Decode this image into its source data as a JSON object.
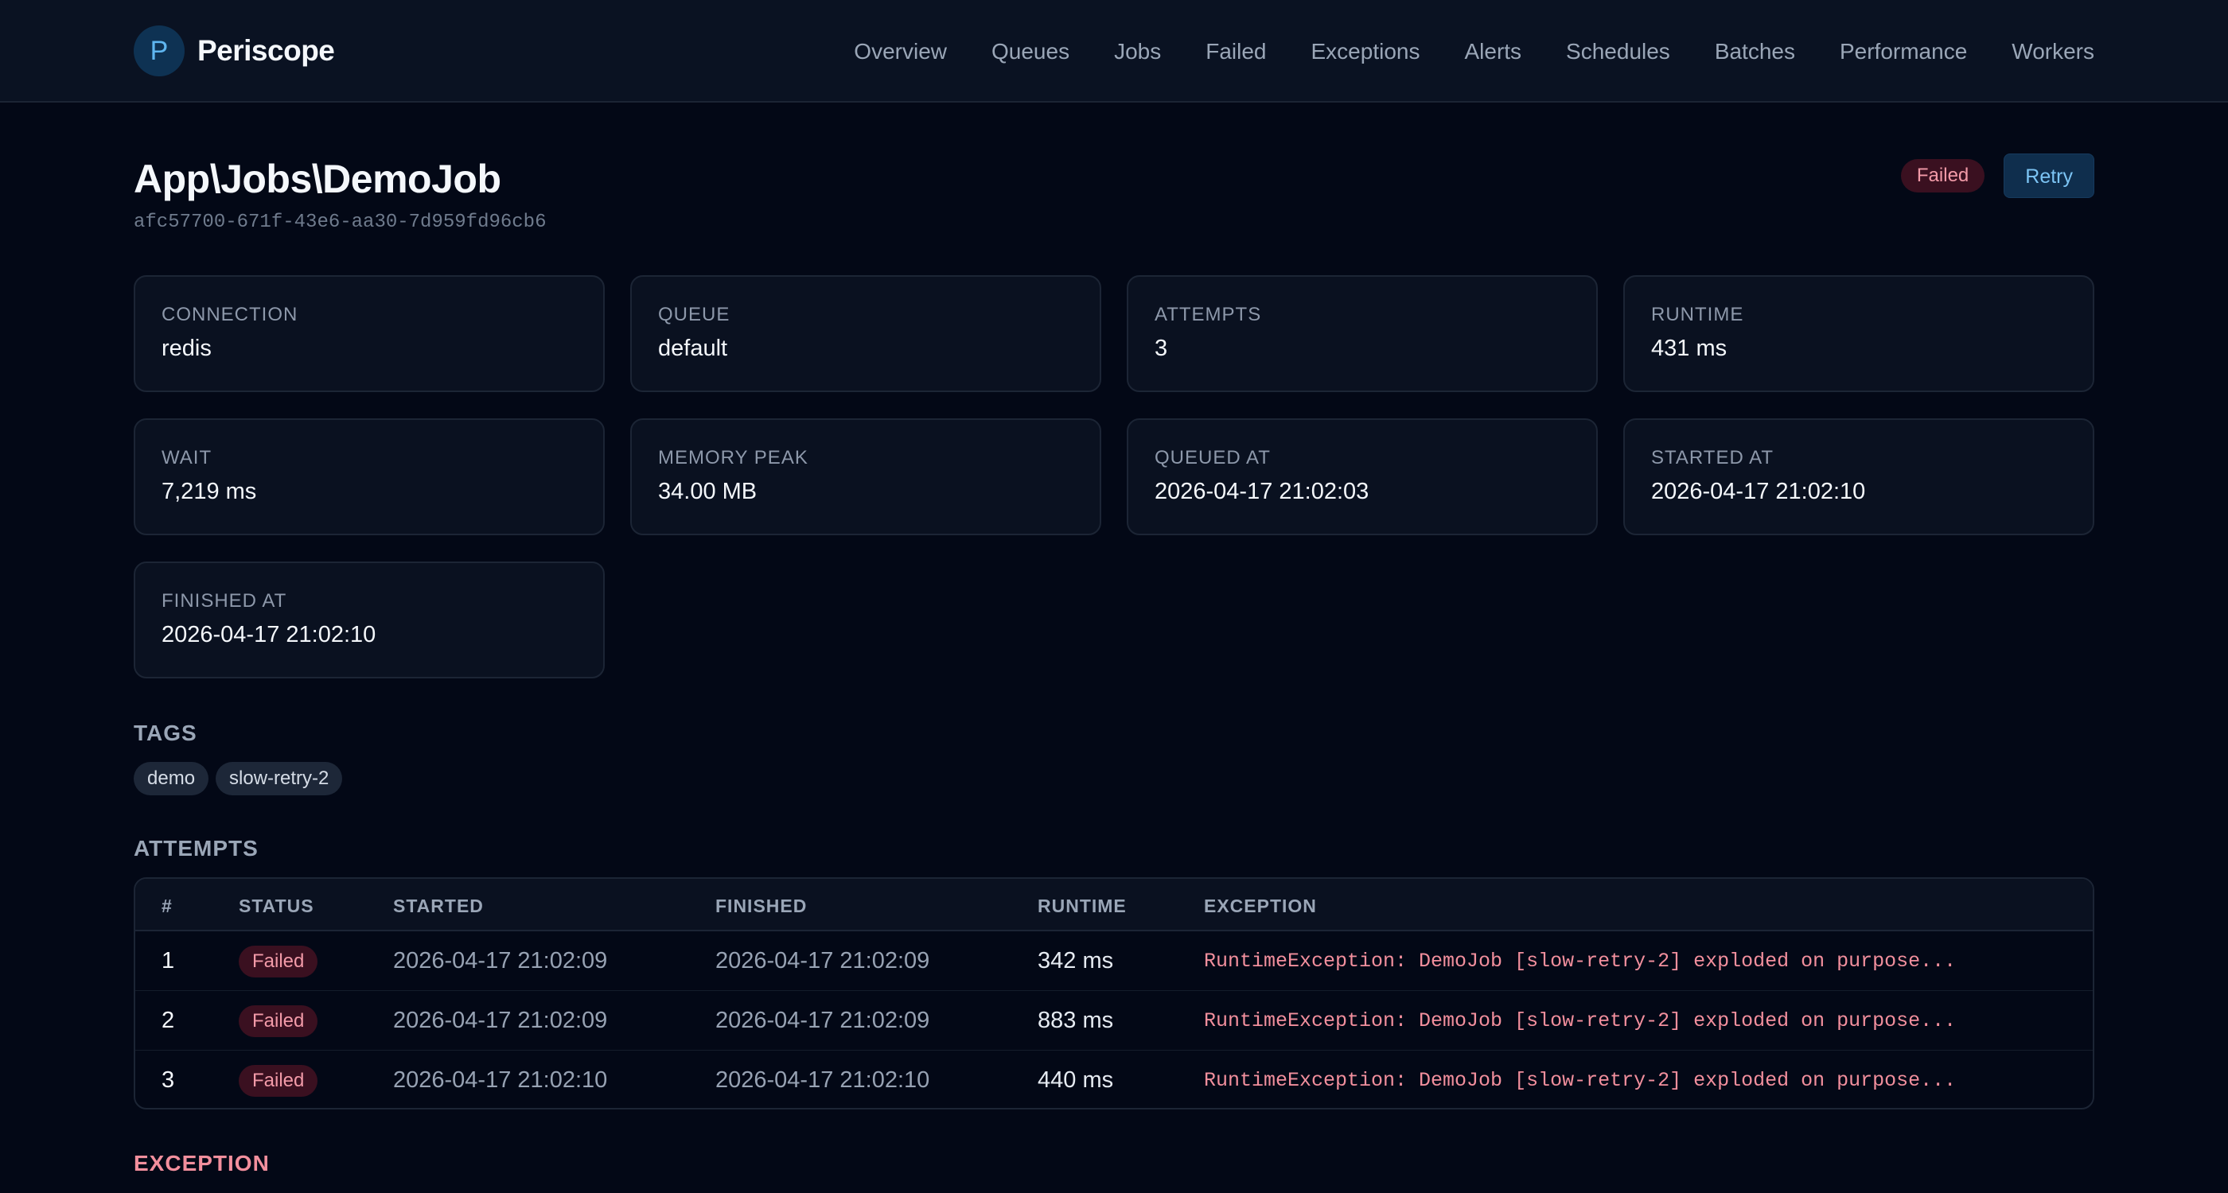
{
  "app": {
    "logo_letter": "P",
    "name": "Periscope"
  },
  "nav": [
    "Overview",
    "Queues",
    "Jobs",
    "Failed",
    "Exceptions",
    "Alerts",
    "Schedules",
    "Batches",
    "Performance",
    "Workers"
  ],
  "job": {
    "title": "App\\Jobs\\DemoJob",
    "uuid": "afc57700-671f-43e6-aa30-7d959fd96cb6",
    "status": "Failed",
    "retry_label": "Retry"
  },
  "stats": [
    {
      "label": "CONNECTION",
      "value": "redis"
    },
    {
      "label": "QUEUE",
      "value": "default"
    },
    {
      "label": "ATTEMPTS",
      "value": "3"
    },
    {
      "label": "RUNTIME",
      "value": "431 ms"
    },
    {
      "label": "WAIT",
      "value": "7,219 ms"
    },
    {
      "label": "MEMORY PEAK",
      "value": "34.00 MB"
    },
    {
      "label": "QUEUED AT",
      "value": "2026-04-17 21:02:03"
    },
    {
      "label": "STARTED AT",
      "value": "2026-04-17 21:02:10"
    },
    {
      "label": "FINISHED AT",
      "value": "2026-04-17 21:02:10"
    }
  ],
  "tags_section": {
    "title": "TAGS",
    "items": [
      "demo",
      "slow-retry-2"
    ]
  },
  "attempts_section": {
    "title": "ATTEMPTS",
    "columns": [
      "#",
      "STATUS",
      "STARTED",
      "FINISHED",
      "RUNTIME",
      "EXCEPTION"
    ],
    "rows": [
      {
        "num": "1",
        "status": "Failed",
        "started": "2026-04-17 21:02:09",
        "finished": "2026-04-17 21:02:09",
        "runtime": "342 ms",
        "exception": "RuntimeException: DemoJob [slow-retry-2] exploded on purpose..."
      },
      {
        "num": "2",
        "status": "Failed",
        "started": "2026-04-17 21:02:09",
        "finished": "2026-04-17 21:02:09",
        "runtime": "883 ms",
        "exception": "RuntimeException: DemoJob [slow-retry-2] exploded on purpose..."
      },
      {
        "num": "3",
        "status": "Failed",
        "started": "2026-04-17 21:02:10",
        "finished": "2026-04-17 21:02:10",
        "runtime": "440 ms",
        "exception": "RuntimeException: DemoJob [slow-retry-2] exploded on purpose..."
      }
    ]
  },
  "exception_section": {
    "title": "EXCEPTION"
  },
  "colors": {
    "background": "#030816",
    "accent": "#5fb6f0",
    "failed": "#f29aa8"
  }
}
